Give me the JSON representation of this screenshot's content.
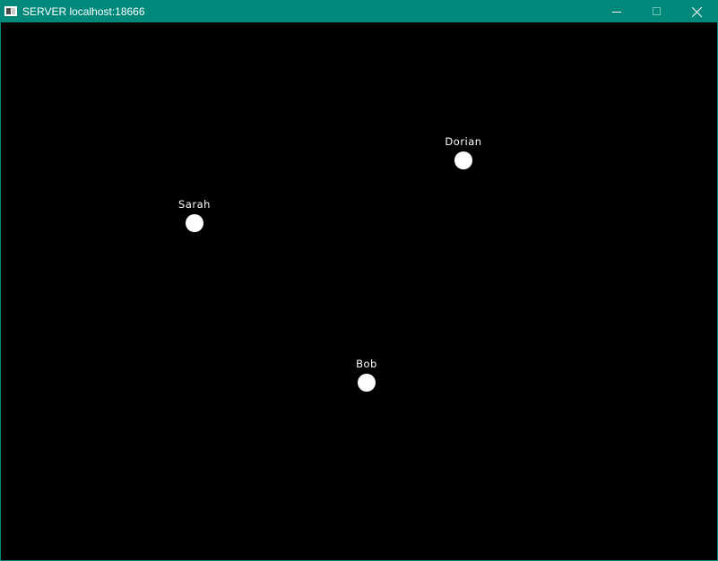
{
  "window": {
    "title": "SERVER localhost:18666",
    "icon": "app-window-icon",
    "controls": {
      "minimize": "minimize-icon",
      "maximize": "maximize-icon",
      "close": "close-icon"
    }
  },
  "colors": {
    "titlebar": "#00897b",
    "canvas_background": "#000000",
    "player_dot": "#ffffff",
    "player_label": "#ffffff"
  },
  "players": [
    {
      "name": "Dorian"
    },
    {
      "name": "Sarah"
    },
    {
      "name": "Bob"
    }
  ]
}
